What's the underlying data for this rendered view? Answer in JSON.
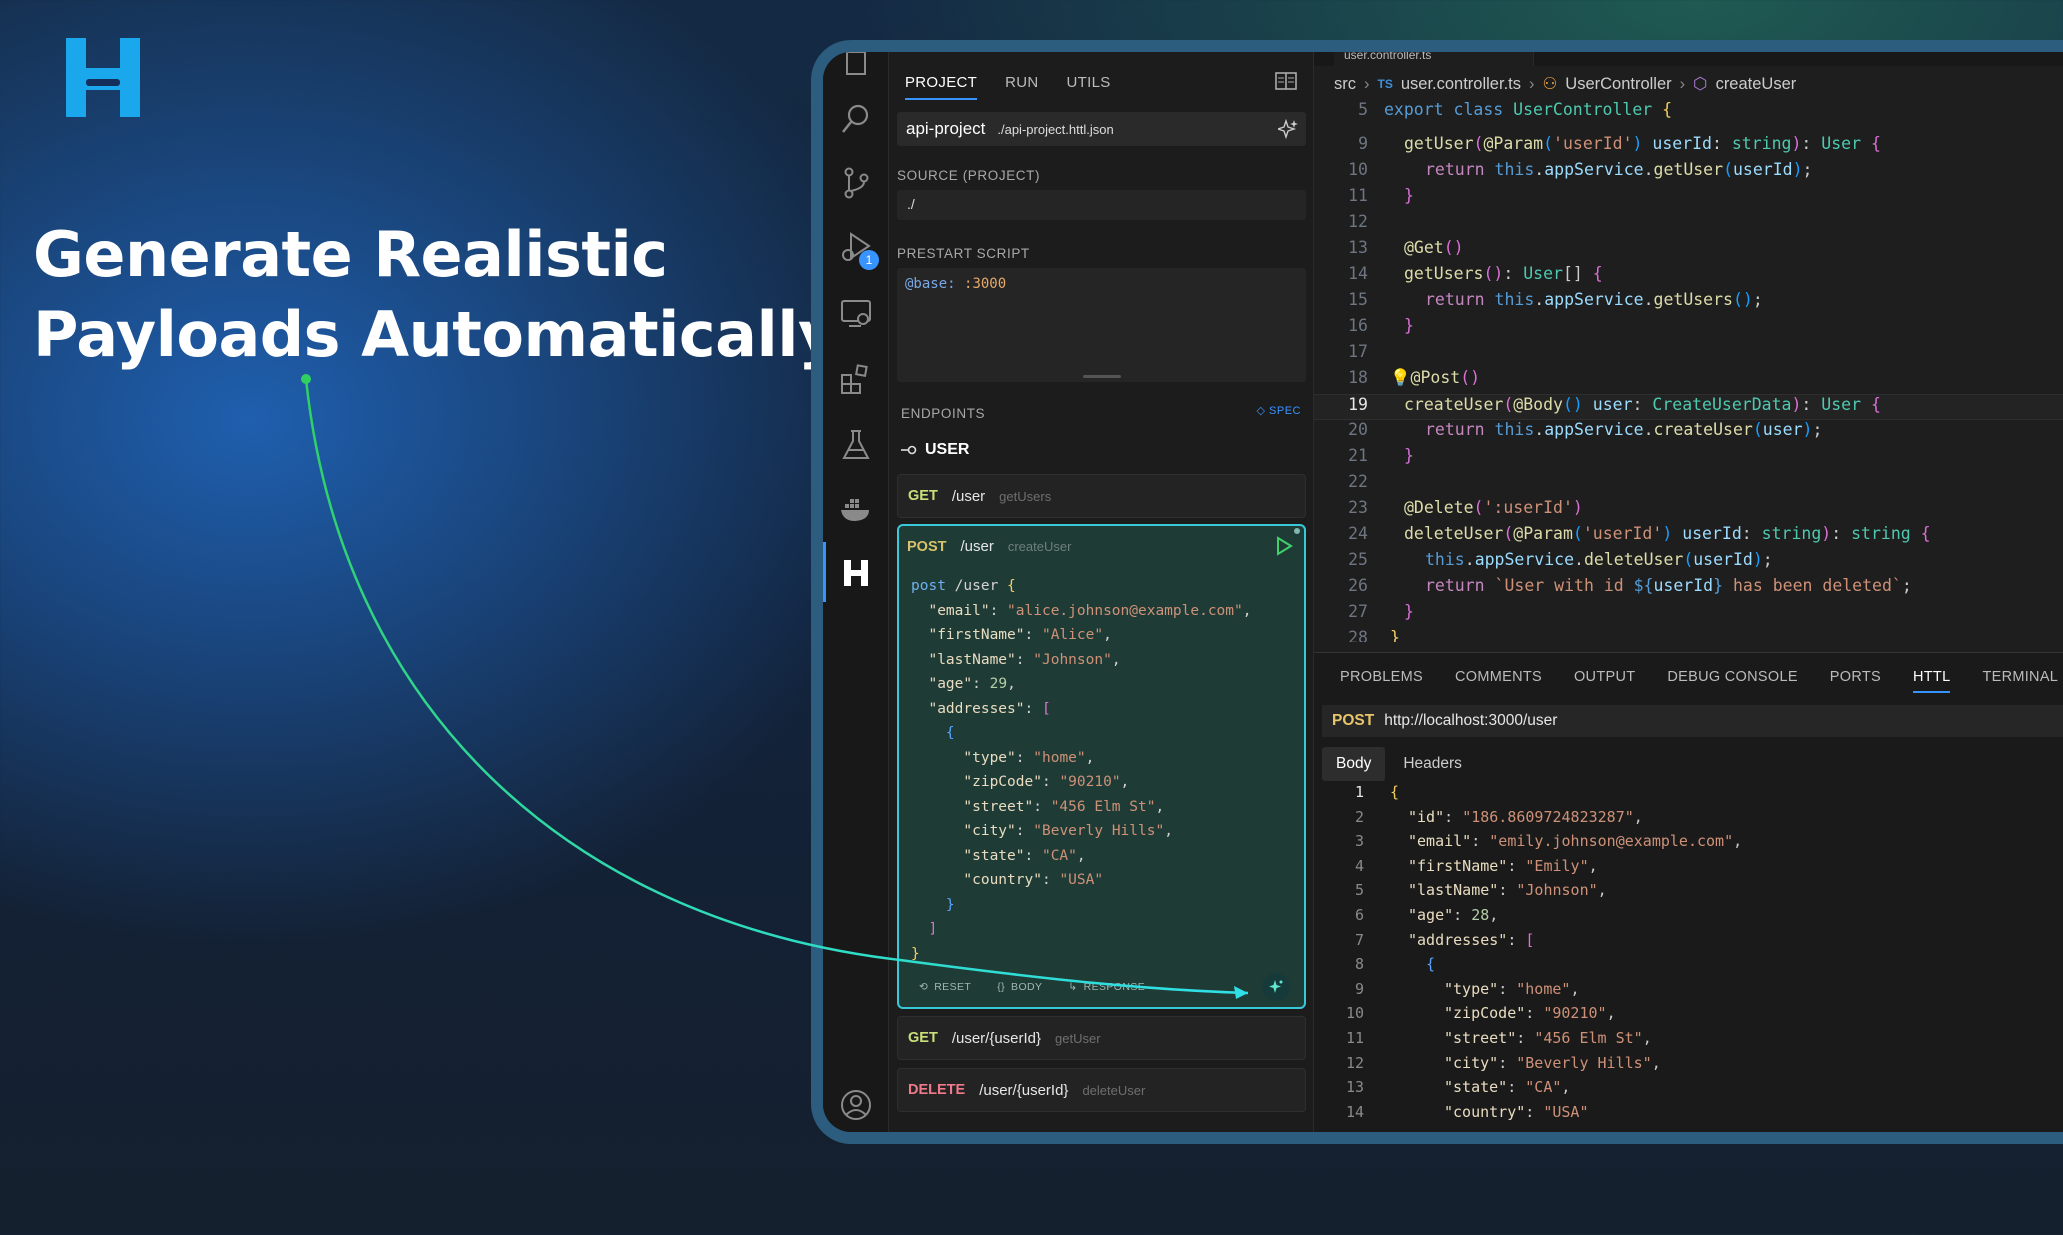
{
  "headline": {
    "line1": "Generate Realistic",
    "line2": "Payloads Automatically"
  },
  "colors": {
    "accent": "#3794ff",
    "highlight_border": "#38c8d8",
    "arrow": "#2fe0c8",
    "logo": "#1aa7ec"
  },
  "sidebar": {
    "tabs": [
      "PROJECT",
      "RUN",
      "UTILS"
    ],
    "active_tab": "PROJECT",
    "project_name": "api-project",
    "project_path": "./api-project.httl.json",
    "source_label": "SOURCE (PROJECT)",
    "source_value": "./",
    "prestart_label": "PRESTART SCRIPT",
    "prestart_base": "@base:",
    "prestart_port": ":3000",
    "endpoints_label": "ENDPOINTS",
    "spec_label": "SPEC",
    "group_name": "USER",
    "badge_count": "1",
    "endpoints": [
      {
        "method": "GET",
        "path": "/user",
        "op": "getUsers"
      },
      {
        "method": "POST",
        "path": "/user",
        "op": "createUser"
      },
      {
        "method": "GET",
        "path": "/user/{userId}",
        "op": "getUser"
      },
      {
        "method": "DELETE",
        "path": "/user/{userId}",
        "op": "deleteUser"
      }
    ],
    "footer": {
      "reset": "RESET",
      "body": "BODY",
      "response": "RESPONSE"
    }
  },
  "expanded_body": {
    "verb": "post",
    "path": "/user",
    "fields": [
      {
        "key": "\"email\"",
        "value": "\"alice.johnson@example.com\""
      },
      {
        "key": "\"firstName\"",
        "value": "\"Alice\""
      },
      {
        "key": "\"lastName\"",
        "value": "\"Johnson\""
      },
      {
        "key": "\"age\"",
        "value": "29"
      }
    ],
    "addresses_key": "\"addresses\"",
    "address": [
      {
        "key": "\"type\"",
        "value": "\"home\""
      },
      {
        "key": "\"zipCode\"",
        "value": "\"90210\""
      },
      {
        "key": "\"street\"",
        "value": "\"456 Elm St\""
      },
      {
        "key": "\"city\"",
        "value": "\"Beverly Hills\""
      },
      {
        "key": "\"state\"",
        "value": "\"CA\""
      },
      {
        "key": "\"country\"",
        "value": "\"USA\""
      }
    ]
  },
  "editor": {
    "tab_title": "user.controller.ts",
    "breadcrumbs": {
      "folder": "src",
      "lang": "TS",
      "file": "user.controller.ts",
      "class": "UserController",
      "method": "createUser"
    },
    "lines": [
      {
        "n": "5",
        "t": "export class UserController {"
      },
      {
        "n": "9",
        "t": "getUser(@Param('userId') userId: string): User {"
      },
      {
        "n": "10",
        "t": "return this.appService.getUser(userId);"
      },
      {
        "n": "11",
        "t": "}"
      },
      {
        "n": "12",
        "t": ""
      },
      {
        "n": "13",
        "t": "@Get()"
      },
      {
        "n": "14",
        "t": "getUsers(): User[] {"
      },
      {
        "n": "15",
        "t": "return this.appService.getUsers();"
      },
      {
        "n": "16",
        "t": "}"
      },
      {
        "n": "17",
        "t": ""
      },
      {
        "n": "18",
        "t": "@Post()"
      },
      {
        "n": "19",
        "t": "createUser(@Body() user: CreateUserData): User {"
      },
      {
        "n": "20",
        "t": "return this.appService.createUser(user);"
      },
      {
        "n": "21",
        "t": "}"
      },
      {
        "n": "22",
        "t": ""
      },
      {
        "n": "23",
        "t": "@Delete(':userId')"
      },
      {
        "n": "24",
        "t": "deleteUser(@Param('userId') userId: string): string {"
      },
      {
        "n": "25",
        "t": "this.appService.deleteUser(userId);"
      },
      {
        "n": "26",
        "t": "return `User with id ${userId} has been deleted`;"
      },
      {
        "n": "27",
        "t": "}"
      },
      {
        "n": "28",
        "t": "}"
      }
    ]
  },
  "panel": {
    "tabs": [
      "PROBLEMS",
      "COMMENTS",
      "OUTPUT",
      "DEBUG CONSOLE",
      "PORTS",
      "HTTL",
      "TERMINAL"
    ],
    "active_tab": "HTTL",
    "request_method": "POST",
    "request_url": "http://localhost:3000/user",
    "resp_tabs": [
      "Body",
      "Headers"
    ],
    "response_lines": [
      {
        "n": "1",
        "t": "{"
      },
      {
        "n": "2",
        "t": "\"id\": \"186.8609724823287\","
      },
      {
        "n": "3",
        "t": "\"email\": \"emily.johnson@example.com\","
      },
      {
        "n": "4",
        "t": "\"firstName\": \"Emily\","
      },
      {
        "n": "5",
        "t": "\"lastName\": \"Johnson\","
      },
      {
        "n": "6",
        "t": "\"age\": 28,"
      },
      {
        "n": "7",
        "t": "\"addresses\": ["
      },
      {
        "n": "8",
        "t": "{"
      },
      {
        "n": "9",
        "t": "\"type\": \"home\","
      },
      {
        "n": "10",
        "t": "\"zipCode\": \"90210\","
      },
      {
        "n": "11",
        "t": "\"street\": \"456 Elm St\","
      },
      {
        "n": "12",
        "t": "\"city\": \"Beverly Hills\","
      },
      {
        "n": "13",
        "t": "\"state\": \"CA\","
      },
      {
        "n": "14",
        "t": "\"country\": \"USA\""
      }
    ]
  }
}
